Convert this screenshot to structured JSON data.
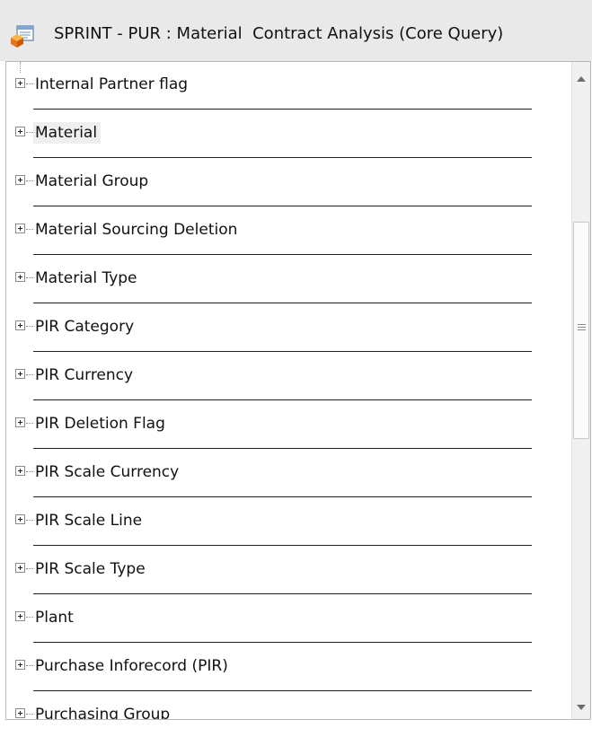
{
  "window": {
    "title": "SPRINT - PUR : Material  Contract Analysis (Core Query)",
    "icon": "query-report-icon"
  },
  "tree": {
    "items": [
      {
        "label": "Internal Partner flag"
      },
      {
        "label": "Material",
        "selected": true
      },
      {
        "label": "Material Group"
      },
      {
        "label": "Material Sourcing Deletion"
      },
      {
        "label": "Material Type"
      },
      {
        "label": "PIR Category"
      },
      {
        "label": "PIR Currency"
      },
      {
        "label": "PIR Deletion Flag"
      },
      {
        "label": "PIR Scale Currency"
      },
      {
        "label": "PIR Scale Line"
      },
      {
        "label": "PIR Scale Type"
      },
      {
        "label": "Plant"
      },
      {
        "label": "Purchase Inforecord (PIR)"
      },
      {
        "label": "Purchasing Group"
      }
    ]
  },
  "scrollbar": {
    "scroll_position": 0.35
  }
}
